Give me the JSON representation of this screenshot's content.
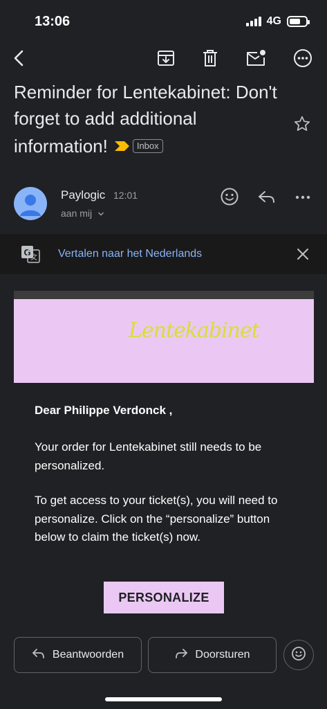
{
  "status_bar": {
    "time": "13:06",
    "network": "4G",
    "signal_bars": 4,
    "battery_level": 0.7
  },
  "toolbar": {
    "back_icon": "back-arrow-icon",
    "archive_icon": "archive-icon",
    "delete_icon": "trash-icon",
    "mark_unread_icon": "mark-unread-icon",
    "more_icon": "more-horizontal-icon"
  },
  "email": {
    "subject": "Reminder for Lentekabinet: Don't forget to add additional information!",
    "label": "Inbox",
    "importance_color": "#fbbc04",
    "sender": {
      "name": "Paylogic",
      "time": "12:01",
      "recipient": "aan mij"
    },
    "translate": {
      "text": "Vertalen naar het Nederlands"
    },
    "body": {
      "logo_text": "Lentekabinet",
      "greeting": "Dear Philippe Verdonck ,",
      "paragraph1": "Your order for Lentekabinet still needs to be personalized.",
      "paragraph2": "To get access to your ticket(s), you will need to personalize. Click on the “personalize” button below to claim the ticket(s) now.",
      "cta_label": "PERSONALIZE",
      "cta_color": "#ebc8f3"
    }
  },
  "actions": {
    "reply_label": "Beantwoorden",
    "forward_label": "Doorsturen"
  },
  "colors": {
    "background": "#202124",
    "link": "#8ab4f8",
    "accent": "#ebc8f3"
  }
}
